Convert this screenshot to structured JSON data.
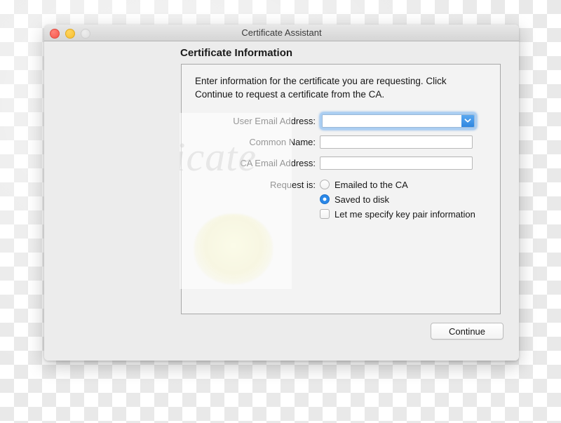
{
  "window": {
    "title": "Certificate Assistant",
    "traffic_lights": [
      {
        "name": "close",
        "color": "#f5554a"
      },
      {
        "name": "minimize",
        "color": "#f7bf2f"
      },
      {
        "name": "zoom",
        "color": "#dedede"
      }
    ]
  },
  "panel": {
    "heading": "Certificate Information",
    "intro": "Enter information for the certificate you are requesting. Click Continue to request a certificate from the CA."
  },
  "form": {
    "fields": [
      {
        "label": "User Email Address:",
        "value": "",
        "placeholder": "",
        "type": "combobox",
        "focused": true
      },
      {
        "label": "Common Name:",
        "value": "",
        "placeholder": "",
        "type": "text",
        "focused": false
      },
      {
        "label": "CA Email Address:",
        "value": "",
        "placeholder": "",
        "type": "text",
        "focused": false
      }
    ],
    "request_is": {
      "label": "Request is:",
      "options": [
        {
          "text": "Emailed to the CA",
          "selected": false
        },
        {
          "text": "Saved to disk",
          "selected": true
        }
      ],
      "checkbox": {
        "text": "Let me specify key pair information",
        "checked": false
      }
    }
  },
  "footer": {
    "continue_label": "Continue"
  },
  "artwork": {
    "script_word": "Certificate"
  },
  "colors": {
    "accent": "#2a88e8",
    "focus_ring": "#6eaff0",
    "window_chrome": "#ececec",
    "frame_blue": "#cbdced",
    "seal_cream": "#f7f6e2"
  }
}
